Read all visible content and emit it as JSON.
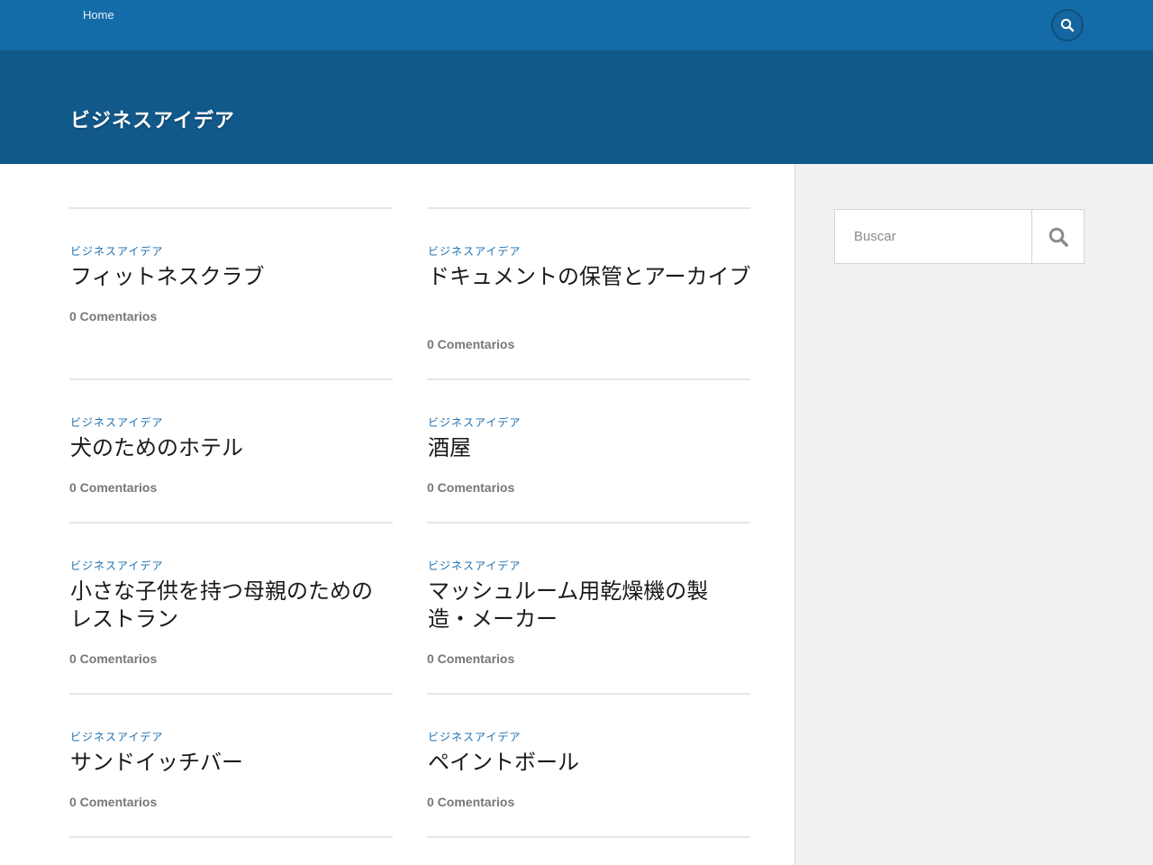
{
  "nav": {
    "home_label": "Home",
    "search_icon": "search-icon"
  },
  "hero": {
    "title": "ビジネスアイデア"
  },
  "posts": [
    {
      "category": "ビジネスアイデア",
      "title": "フィットネスクラブ",
      "comments": "0 Comentarios"
    },
    {
      "category": "ビジネスアイデア",
      "title": "ドキュメントの保管とアーカイブ",
      "comments": "0 Comentarios"
    },
    {
      "category": "ビジネスアイデア",
      "title": "犬のためのホテル",
      "comments": "0 Comentarios"
    },
    {
      "category": "ビジネスアイデア",
      "title": "酒屋",
      "comments": "0 Comentarios"
    },
    {
      "category": "ビジネスアイデア",
      "title": "小さな子供を持つ母親のためのレストラン",
      "comments": "0 Comentarios"
    },
    {
      "category": "ビジネスアイデア",
      "title": "マッシュルーム用乾燥機の製造・メーカー",
      "comments": "0 Comentarios"
    },
    {
      "category": "ビジネスアイデア",
      "title": "サンドイッチバー",
      "comments": "0 Comentarios"
    },
    {
      "category": "ビジネスアイデア",
      "title": "ペイントボール",
      "comments": "0 Comentarios"
    }
  ],
  "sidebar": {
    "search": {
      "placeholder": "Buscar",
      "value": "",
      "button_icon": "search-icon"
    }
  },
  "colors": {
    "topbar": "#136ca7",
    "hero": "#11598a",
    "accent": "#1a6fb0",
    "sidebar_bg": "#f1f1f1"
  }
}
